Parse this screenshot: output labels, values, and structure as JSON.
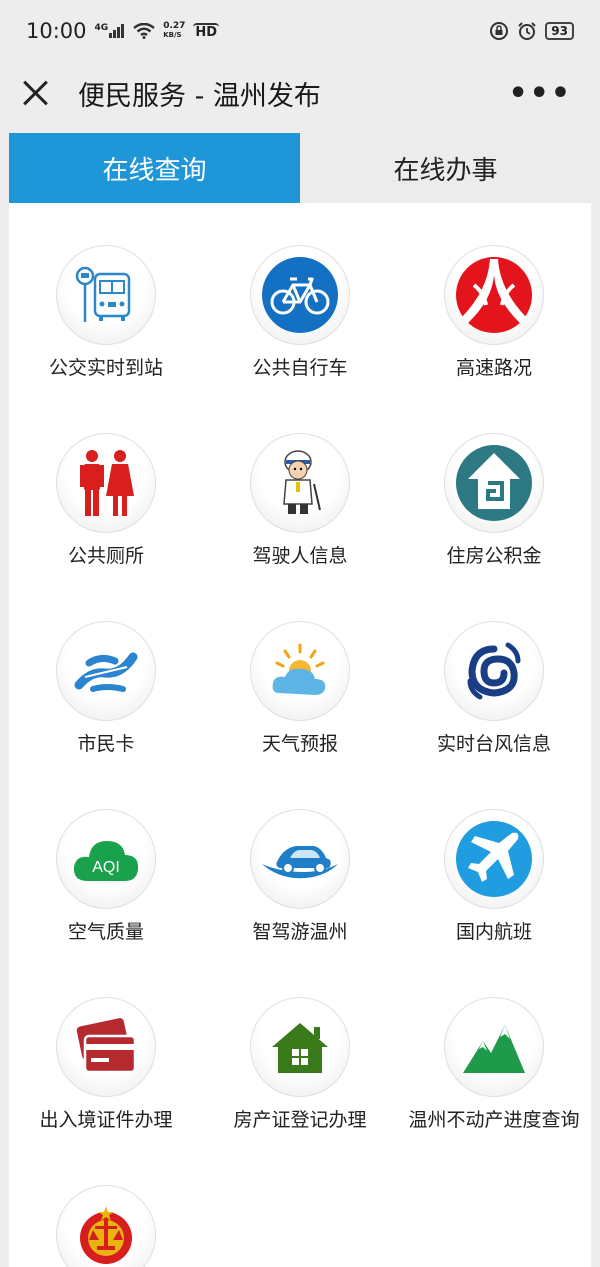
{
  "status": {
    "time": "10:00",
    "net_top": "4G",
    "speed_value": "0.27",
    "speed_unit": "KB/S",
    "hd": "HD",
    "battery": "93"
  },
  "header": {
    "title": "便民服务 - 温州发布",
    "more": "•••"
  },
  "tabs": [
    {
      "label": "在线查询",
      "active": true
    },
    {
      "label": "在线办事",
      "active": false
    }
  ],
  "services": [
    {
      "label": "公交实时到站",
      "icon": "bus-stop-icon"
    },
    {
      "label": "公共自行车",
      "icon": "bicycle-icon"
    },
    {
      "label": "高速路况",
      "icon": "highway-icon"
    },
    {
      "label": "公共厕所",
      "icon": "restroom-icon"
    },
    {
      "label": "驾驶人信息",
      "icon": "traffic-police-icon"
    },
    {
      "label": "住房公积金",
      "icon": "housing-fund-icon"
    },
    {
      "label": "市民卡",
      "icon": "citizen-card-icon"
    },
    {
      "label": "天气预报",
      "icon": "weather-icon"
    },
    {
      "label": "实时台风信息",
      "icon": "typhoon-icon"
    },
    {
      "label": "空气质量",
      "icon": "air-quality-icon",
      "icon_text": "AQI"
    },
    {
      "label": "智驾游温州",
      "icon": "car-icon"
    },
    {
      "label": "国内航班",
      "icon": "airplane-icon"
    },
    {
      "label": "出入境证件办理",
      "icon": "id-card-icon"
    },
    {
      "label": "房产证登记办理",
      "icon": "house-icon"
    },
    {
      "label": "温州不动产进度查询",
      "icon": "mountain-icon"
    },
    {
      "label": "",
      "icon": "court-emblem-icon"
    }
  ],
  "colors": {
    "accent": "#1e96d8",
    "tab_inactive": "#ececec",
    "background": "#ededed"
  }
}
